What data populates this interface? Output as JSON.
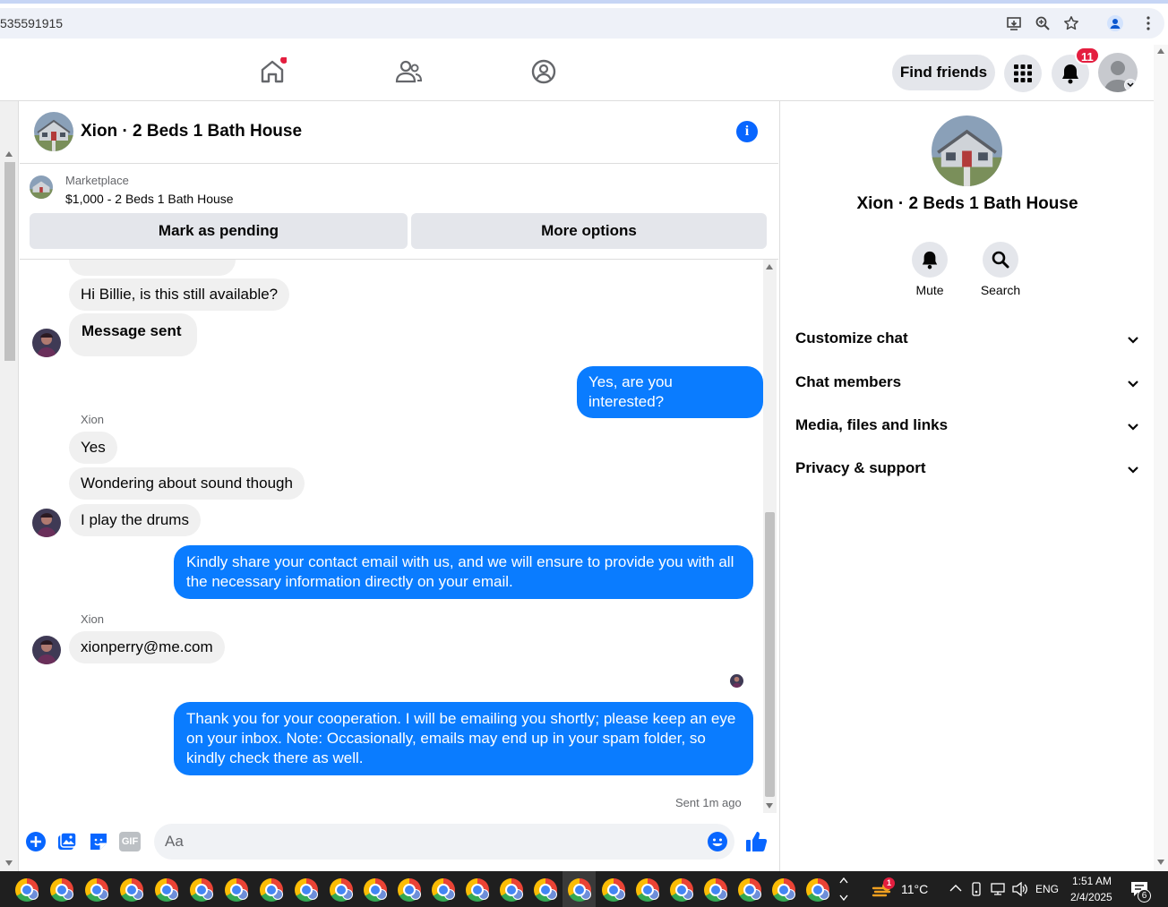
{
  "browser": {
    "url_fragment": "535591915"
  },
  "nav": {
    "find_friends_label": "Find friends",
    "notification_count": "11"
  },
  "chat": {
    "title": "Xion · 2 Beds 1 Bath House",
    "marketplace_label": "Marketplace",
    "listing": "$1,000 - 2 Beds 1 Bath House",
    "mark_pending_label": "Mark as pending",
    "more_options_label": "More options",
    "messages": [
      {
        "dir": "in",
        "text": "Hi Billie, is this still available?"
      },
      {
        "dir": "in",
        "text": "Message sent"
      },
      {
        "dir": "out",
        "text": "Yes, are you interested?"
      },
      {
        "sender": "Xion"
      },
      {
        "dir": "in",
        "text": "Yes"
      },
      {
        "dir": "in",
        "text": "Wondering about sound though"
      },
      {
        "dir": "in",
        "text": "I play the drums"
      },
      {
        "dir": "out",
        "text": "Kindly share your contact email with us, and we will ensure to provide you with all the necessary information directly on your email."
      },
      {
        "sender": "Xion"
      },
      {
        "dir": "in",
        "text": "xionperry@me.com"
      },
      {
        "dir": "out",
        "text": "Thank you for your cooperation. I will be emailing you shortly; please keep an eye on your inbox. Note: Occasionally, emails may end up in your spam folder, so kindly check there as well."
      }
    ],
    "sent_status": "Sent 1m ago",
    "composer_placeholder": "Aa"
  },
  "info_panel": {
    "title": "Xion · 2 Beds 1 Bath House",
    "actions": [
      "Mute",
      "Search"
    ],
    "sections": [
      "Customize chat",
      "Chat members",
      "Media, files and links",
      "Privacy & support"
    ]
  },
  "taskbar": {
    "weather": "11°C",
    "weather_alert": "1",
    "language": "ENG",
    "time": "1:51 AM",
    "date": "2/4/2025",
    "notification_count": "6",
    "gif_label": "GIF"
  },
  "colors": {
    "messenger_blue": "#0a7cff",
    "fb_blue": "#0866ff",
    "badge_red": "#e41e3f"
  }
}
